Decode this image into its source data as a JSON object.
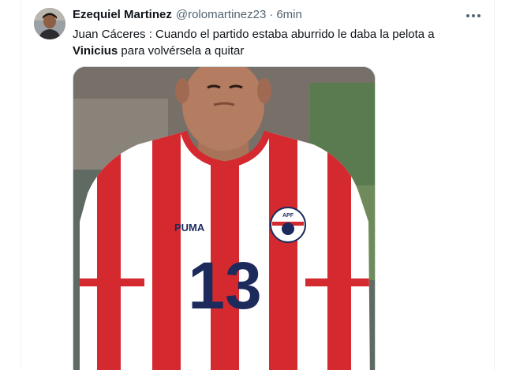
{
  "tweet": {
    "author_name": "Ezequiel Martinez",
    "handle": "@rolomartinez23",
    "separator": "·",
    "time": "6min",
    "text_part1": "Juan Cáceres : Cuando el partido estaba aburrido le daba la pelota a",
    "text_bold": "Vinicius",
    "text_part2": " para volvérsela a quitar"
  },
  "media": {
    "jersey_brand": "PUMA",
    "jersey_number": "13",
    "badge_text": "APF"
  },
  "colors": {
    "text_primary": "#0f1419",
    "text_secondary": "#536471",
    "jersey_red": "#d42a2f",
    "jersey_navy": "#1d2b5c"
  },
  "icons": {
    "more": "more-horizontal-icon"
  }
}
